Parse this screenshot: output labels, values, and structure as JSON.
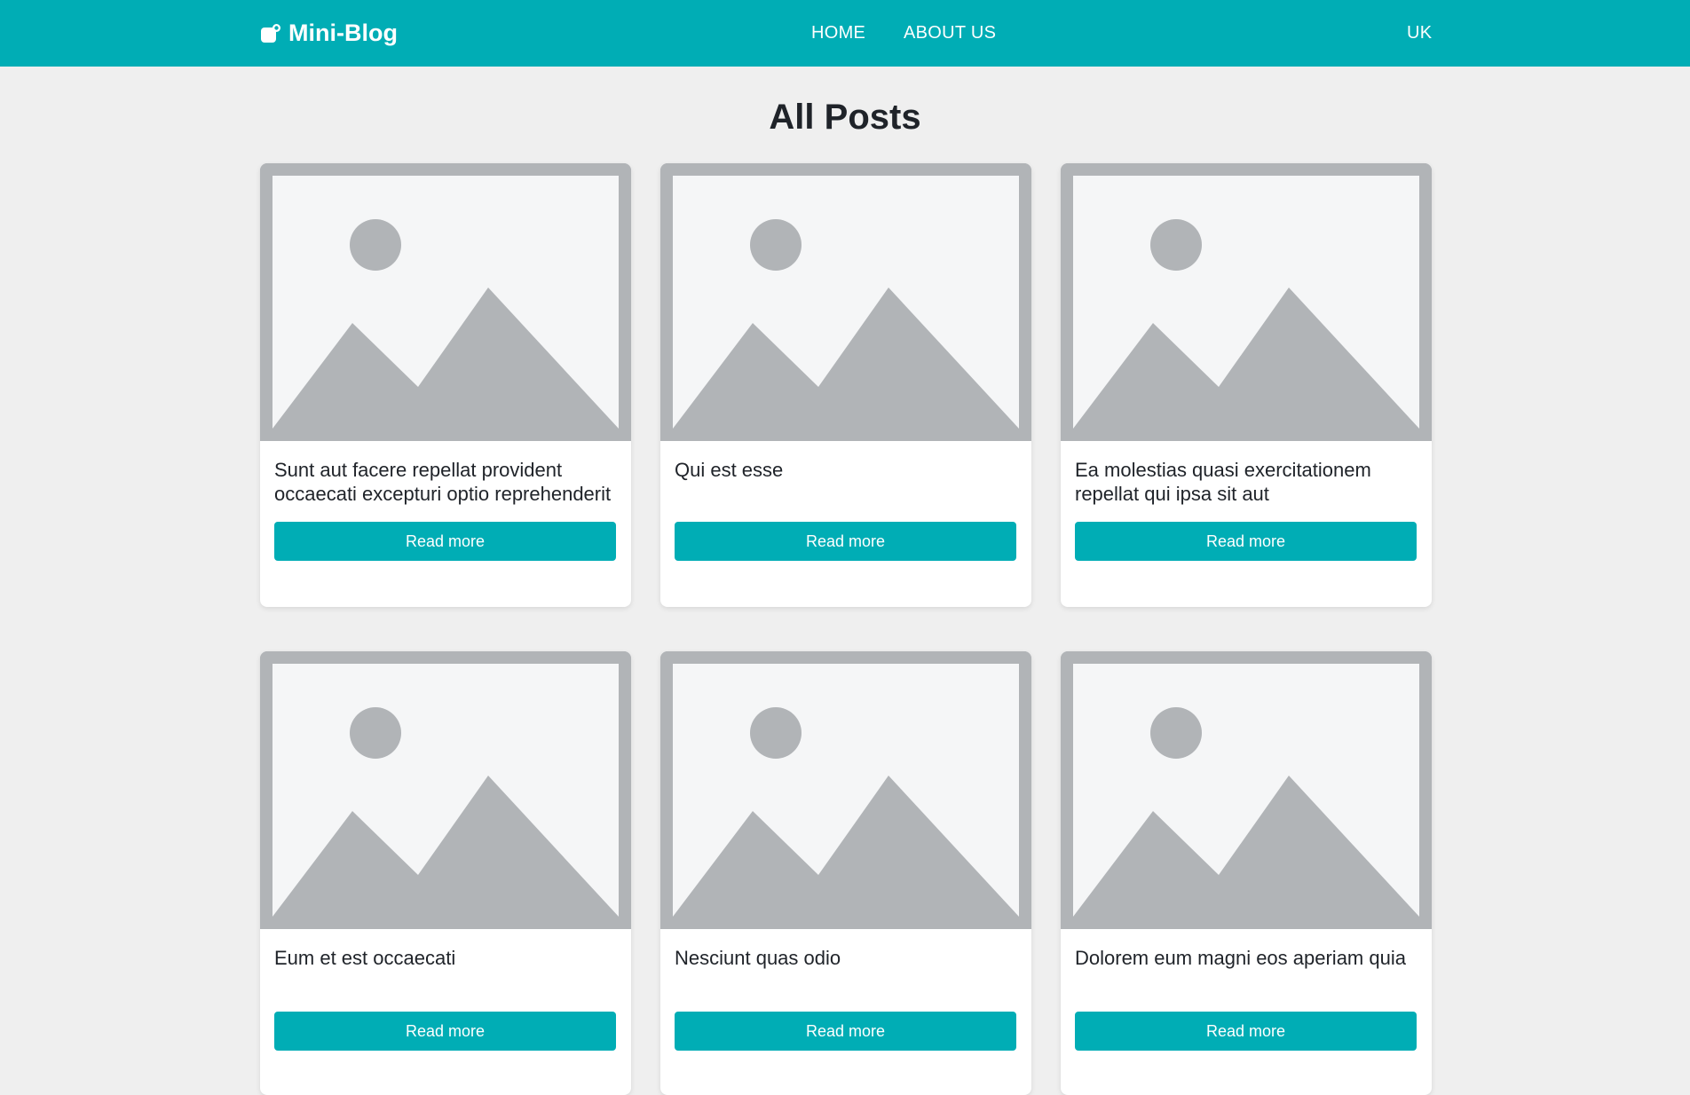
{
  "navbar": {
    "brand": "Mini-Blog",
    "brand_icon": "blog-logo-icon",
    "links": [
      "HOME",
      "ABOUT US"
    ],
    "language": "UK",
    "color": "#00adb5"
  },
  "page": {
    "title": "All Posts"
  },
  "posts": [
    {
      "title": "Sunt aut facere repellat provident occaecati excepturi optio reprehenderit",
      "button": "Read more",
      "image_icon": "image-placeholder-icon"
    },
    {
      "title": "Qui est esse",
      "button": "Read more",
      "image_icon": "image-placeholder-icon"
    },
    {
      "title": "Ea molestias quasi exercitationem repellat qui ipsa sit aut",
      "button": "Read more",
      "image_icon": "image-placeholder-icon"
    },
    {
      "title": "Eum et est occaecati",
      "button": "Read more",
      "image_icon": "image-placeholder-icon"
    },
    {
      "title": "Nesciunt quas odio",
      "button": "Read more",
      "image_icon": "image-placeholder-icon"
    },
    {
      "title": "Dolorem eum magni eos aperiam quia",
      "button": "Read more",
      "image_icon": "image-placeholder-icon"
    }
  ]
}
